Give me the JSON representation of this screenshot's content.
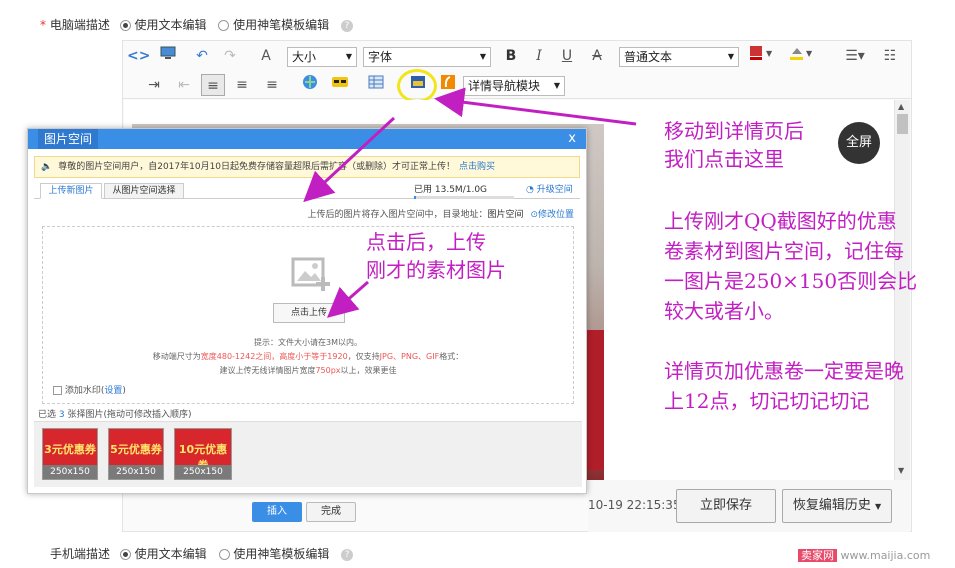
{
  "pc_row": {
    "required_mark": "*",
    "label": "电脑端描述",
    "opt1": "使用文本编辑",
    "opt2": "使用神笔模板编辑"
  },
  "mobile_row": {
    "label": "手机端描述",
    "opt1": "使用文本编辑",
    "opt2": "使用神笔模板编辑"
  },
  "toolbar": {
    "font_size": "大小",
    "font_family": "字体",
    "bold": "B",
    "italic": "I",
    "underline": "U",
    "strike": "A",
    "paragraph": "普通文本",
    "nav_module": "详情导航模块"
  },
  "editor": {
    "fullscreen": "全屏",
    "timestamp": "10-19 22:15:35",
    "save_now": "立即保存",
    "restore_history": "恢复编辑历史"
  },
  "dialog": {
    "title": "图片空间",
    "close": "x",
    "notice": "尊敬的图片空间用户，自2017年10月10日起免费存储容量超限后需扩容（或删除）才可正常上传！",
    "notice_link": "点击购买",
    "tab_upload": "上传新图片",
    "tab_select": "从图片空间选择",
    "used_label": "已用",
    "used_value": "13.5M/1.0G",
    "upgrade": "升级空间",
    "path_text": "上传后的图片将存入图片空间中，目录地址：",
    "path_name": "图片空间",
    "change_location": "修改位置",
    "upload_button": "点击上传",
    "tip1": "提示：文件大小请在3M以内。",
    "tip2_a": "移动端尺寸为",
    "tip2_b": "宽度480-1242之间，高度小于等于1920",
    "tip2_c": "，仅支持",
    "tip2_d": "JPG、PNG、GIF",
    "tip2_e": "格式：",
    "tip3_a": "建议上传无线详情图片宽度",
    "tip3_b": "750px",
    "tip3_c": "以上，效果更佳",
    "watermark": "添加水印",
    "watermark_settings": "设置",
    "selected_a": "已选",
    "selected_count": "3",
    "selected_b": "张择图片(拖动可修改插入顺序)",
    "coupons": [
      {
        "title": "3元优惠券",
        "size": "250x150"
      },
      {
        "title": "5元优惠券",
        "size": "250x150"
      },
      {
        "title": "10元优惠券",
        "size": "250x150"
      }
    ],
    "insert": "插入",
    "done": "完成"
  },
  "annotations": {
    "a1_line1": "移动到详情页后",
    "a1_line2": "我们点击这里",
    "a2_line1": "点击后，上传",
    "a2_line2": "刚才的素材图片",
    "a3_line1": "上传刚才QQ截图好的优惠",
    "a3_line2": "卷素材到图片空间，记住每",
    "a3_line3": "一图片是250×150否则会比",
    "a3_line4": "较大或者小。",
    "a4_line1": "详情页加优惠卷一定要是晚",
    "a4_line2": "上12点，切记切记切记"
  },
  "watermark_site": {
    "brand": "卖家网",
    "url": "www.maijia.com"
  },
  "colors": {
    "annotation": "#c21fc2",
    "dialog_header": "#3a8ee6",
    "insert_button": "#3a8ee6",
    "highlight_circle": "#f2e51c"
  }
}
